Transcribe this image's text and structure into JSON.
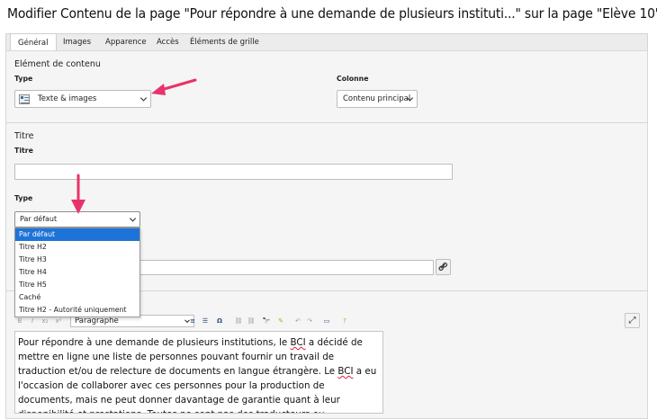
{
  "page_title": "Modifier Contenu de la page \"Pour répondre à une demande de plusieurs instituti...\" sur la page \"Elève 10\"",
  "tabs": [
    {
      "label": "Général"
    },
    {
      "label": "Images"
    },
    {
      "label": "Apparence"
    },
    {
      "label": "Accès"
    },
    {
      "label": "Éléments de grille"
    }
  ],
  "content_element": {
    "section_title": "Elément de contenu",
    "type_label": "Type",
    "type_value": "Texte & images",
    "type_icon": "text-image-icon",
    "column_label": "Colonne",
    "column_value": "Contenu principal"
  },
  "heading": {
    "section_title": "Titre",
    "title_label": "Titre",
    "title_value": "",
    "type_label": "Type",
    "type_value": "Par défaut",
    "type_options": [
      "Par défaut",
      "Titre H2",
      "Titre H3",
      "Titre H4",
      "Titre H5",
      "Caché",
      "Titre H2 - Autorité uniquement"
    ],
    "link_icon": "link-icon"
  },
  "editor": {
    "format_value": "Paragraphe",
    "text_before_bci": "Pour répondre à une demande de plusieurs institutions, le ",
    "text_bci": "BCI",
    "text_after_bci": " a décidé de mettre en ligne une liste de personnes pouvant fournir un travail de traduction et/ou de relecture de documents en langue étrangère. Le ",
    "text_bci2": "BCI",
    "text_after_bci2": " a eu l'occasion de collaborer avec ces personnes pour la production de documents, mais ne peut donner davantage de garantie quant à leur disponibilité et prestations. Toutes ne sont pas des traducteurs ou traductrices certifiées, mais elles sont au bénéfice d'une",
    "fullscreen_icon": "expand-icon"
  },
  "colors": {
    "annotation_arrow": "#e8336a",
    "selected_option": "#1e73d8"
  }
}
